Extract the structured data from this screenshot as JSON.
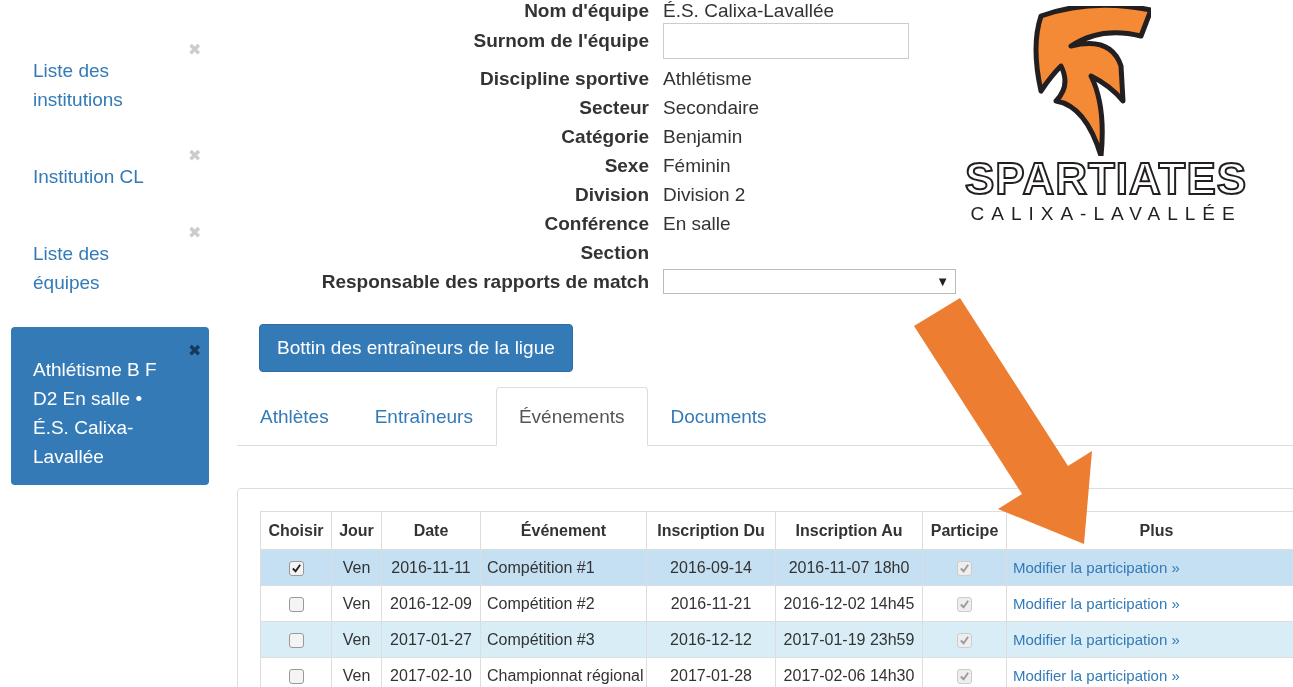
{
  "sidebar": {
    "items": [
      {
        "label": "Liste des institutions",
        "selected": false,
        "close": "✖"
      },
      {
        "label": "Institution CL",
        "selected": false,
        "close": "✖"
      },
      {
        "label": "Liste des équipes",
        "selected": false,
        "close": "✖"
      },
      {
        "label": "Athlétisme B F D2 En salle • É.S. Calixa-Lavallée",
        "selected": true,
        "close": "✖"
      }
    ]
  },
  "form": {
    "fields": [
      {
        "label": "Nom d'équipe",
        "kind": "text",
        "value": "É.S. Calixa-Lavallée"
      },
      {
        "label": "Surnom de l'équipe",
        "kind": "input"
      },
      {
        "label": "Discipline sportive",
        "kind": "text",
        "value": "Athlétisme"
      },
      {
        "label": "Secteur",
        "kind": "text",
        "value": "Secondaire"
      },
      {
        "label": "Catégorie",
        "kind": "text",
        "value": "Benjamin"
      },
      {
        "label": "Sexe",
        "kind": "text",
        "value": "Féminin"
      },
      {
        "label": "Division",
        "kind": "text",
        "value": "Division 2"
      },
      {
        "label": "Conférence",
        "kind": "text",
        "value": "En salle"
      },
      {
        "label": "Section",
        "kind": "text"
      },
      {
        "label": "Responsable des rapports de match",
        "kind": "select",
        "caret": "▼"
      }
    ]
  },
  "logo": {
    "name": "SPARTIATES",
    "subtitle": "CALIXA-LAVALLÉE"
  },
  "directory_button": "Bottin des entraîneurs de la ligue",
  "tabs": [
    {
      "label": "Athlètes",
      "selected": false
    },
    {
      "label": "Entraîneurs",
      "selected": false
    },
    {
      "label": "Événements",
      "selected": true
    },
    {
      "label": "Documents",
      "selected": false
    }
  ],
  "table": {
    "columns": [
      "Choisir",
      "Jour",
      "Date",
      "Événement",
      "Inscription Du",
      "Inscription Au",
      "Participe",
      "Plus"
    ],
    "rows": [
      {
        "chosen": true,
        "selected": true,
        "day": "Ven",
        "date": "2016-11-11",
        "event": "Compétition #1",
        "from": "2016-09-14",
        "to": "2016-11-07 18h0",
        "participates": true,
        "link": "Modifier la participation »"
      },
      {
        "chosen": false,
        "selected": false,
        "day": "Ven",
        "date": "2016-12-09",
        "event": "Compétition #2",
        "from": "2016-11-21",
        "to": "2016-12-02 14h45",
        "participates": true,
        "link": "Modifier la participation »"
      },
      {
        "chosen": false,
        "selected": false,
        "day": "Ven",
        "date": "2017-01-27",
        "event": "Compétition #3",
        "from": "2016-12-12",
        "to": "2017-01-19 23h59",
        "participates": true,
        "link": "Modifier la participation »"
      },
      {
        "chosen": false,
        "selected": false,
        "day": "Ven",
        "date": "2017-02-10",
        "event": "Championnat régional",
        "from": "2017-01-28",
        "to": "2017-02-06 14h30",
        "participates": true,
        "link": "Modifier la participation »"
      }
    ]
  }
}
